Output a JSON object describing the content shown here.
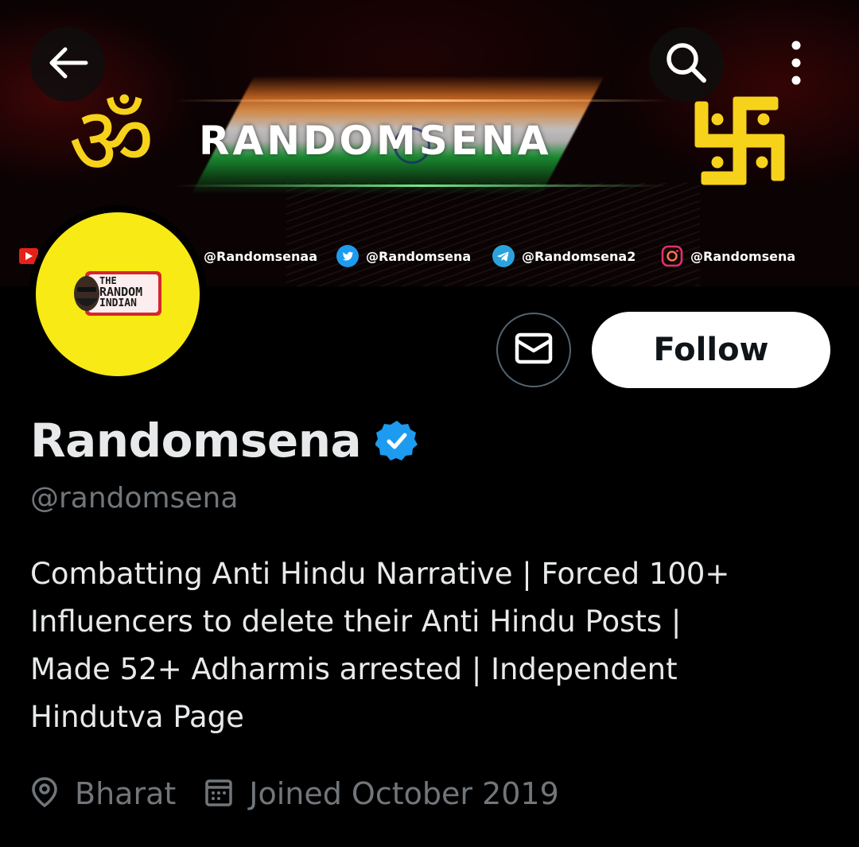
{
  "banner": {
    "title": "RANDOMSENA",
    "om_symbol": "ॐ",
    "social_links": [
      {
        "icon": "youtube-icon",
        "handle": "@Randomsenaa"
      },
      {
        "icon": "twitter-icon",
        "handle": "@Randomsena"
      },
      {
        "icon": "telegram-icon",
        "handle": "@Randomsena2"
      },
      {
        "icon": "instagram-icon",
        "handle": "@Randomsena"
      }
    ]
  },
  "avatar": {
    "line1": "THE",
    "line2": "RANDOM",
    "line3": "INDIAN"
  },
  "header": {
    "back_icon": "back-arrow-icon",
    "search_icon": "search-icon",
    "more_icon": "more-vertical-icon"
  },
  "actions": {
    "message_icon": "envelope-icon",
    "follow_label": "Follow"
  },
  "profile": {
    "display_name": "Randomsena",
    "verified": true,
    "handle": "@randomsena",
    "bio_lines": [
      "Combatting Anti Hindu Narrative | Forced 100+",
      "Influencers to delete their Anti Hindu Posts |",
      "Made 52+ Adharmis arrested | Independent",
      "Hindutva Page"
    ],
    "location": "Bharat",
    "joined": "Joined October 2019"
  },
  "colors": {
    "background": "#000000",
    "text_primary": "#e7e9ea",
    "text_secondary": "#71767b",
    "verified_blue": "#1d9bf0",
    "avatar_yellow": "#f8ea15",
    "banner_gold": "#f7d21b"
  }
}
